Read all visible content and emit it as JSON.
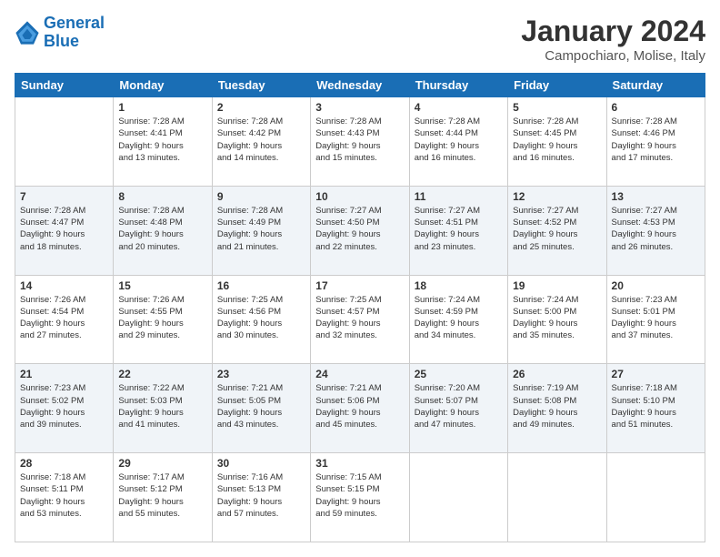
{
  "logo": {
    "line1": "General",
    "line2": "Blue"
  },
  "title": "January 2024",
  "location": "Campochiaro, Molise, Italy",
  "weekdays": [
    "Sunday",
    "Monday",
    "Tuesday",
    "Wednesday",
    "Thursday",
    "Friday",
    "Saturday"
  ],
  "weeks": [
    [
      {
        "day": "",
        "info": ""
      },
      {
        "day": "1",
        "info": "Sunrise: 7:28 AM\nSunset: 4:41 PM\nDaylight: 9 hours\nand 13 minutes."
      },
      {
        "day": "2",
        "info": "Sunrise: 7:28 AM\nSunset: 4:42 PM\nDaylight: 9 hours\nand 14 minutes."
      },
      {
        "day": "3",
        "info": "Sunrise: 7:28 AM\nSunset: 4:43 PM\nDaylight: 9 hours\nand 15 minutes."
      },
      {
        "day": "4",
        "info": "Sunrise: 7:28 AM\nSunset: 4:44 PM\nDaylight: 9 hours\nand 16 minutes."
      },
      {
        "day": "5",
        "info": "Sunrise: 7:28 AM\nSunset: 4:45 PM\nDaylight: 9 hours\nand 16 minutes."
      },
      {
        "day": "6",
        "info": "Sunrise: 7:28 AM\nSunset: 4:46 PM\nDaylight: 9 hours\nand 17 minutes."
      }
    ],
    [
      {
        "day": "7",
        "info": "Sunrise: 7:28 AM\nSunset: 4:47 PM\nDaylight: 9 hours\nand 18 minutes."
      },
      {
        "day": "8",
        "info": "Sunrise: 7:28 AM\nSunset: 4:48 PM\nDaylight: 9 hours\nand 20 minutes."
      },
      {
        "day": "9",
        "info": "Sunrise: 7:28 AM\nSunset: 4:49 PM\nDaylight: 9 hours\nand 21 minutes."
      },
      {
        "day": "10",
        "info": "Sunrise: 7:27 AM\nSunset: 4:50 PM\nDaylight: 9 hours\nand 22 minutes."
      },
      {
        "day": "11",
        "info": "Sunrise: 7:27 AM\nSunset: 4:51 PM\nDaylight: 9 hours\nand 23 minutes."
      },
      {
        "day": "12",
        "info": "Sunrise: 7:27 AM\nSunset: 4:52 PM\nDaylight: 9 hours\nand 25 minutes."
      },
      {
        "day": "13",
        "info": "Sunrise: 7:27 AM\nSunset: 4:53 PM\nDaylight: 9 hours\nand 26 minutes."
      }
    ],
    [
      {
        "day": "14",
        "info": "Sunrise: 7:26 AM\nSunset: 4:54 PM\nDaylight: 9 hours\nand 27 minutes."
      },
      {
        "day": "15",
        "info": "Sunrise: 7:26 AM\nSunset: 4:55 PM\nDaylight: 9 hours\nand 29 minutes."
      },
      {
        "day": "16",
        "info": "Sunrise: 7:25 AM\nSunset: 4:56 PM\nDaylight: 9 hours\nand 30 minutes."
      },
      {
        "day": "17",
        "info": "Sunrise: 7:25 AM\nSunset: 4:57 PM\nDaylight: 9 hours\nand 32 minutes."
      },
      {
        "day": "18",
        "info": "Sunrise: 7:24 AM\nSunset: 4:59 PM\nDaylight: 9 hours\nand 34 minutes."
      },
      {
        "day": "19",
        "info": "Sunrise: 7:24 AM\nSunset: 5:00 PM\nDaylight: 9 hours\nand 35 minutes."
      },
      {
        "day": "20",
        "info": "Sunrise: 7:23 AM\nSunset: 5:01 PM\nDaylight: 9 hours\nand 37 minutes."
      }
    ],
    [
      {
        "day": "21",
        "info": "Sunrise: 7:23 AM\nSunset: 5:02 PM\nDaylight: 9 hours\nand 39 minutes."
      },
      {
        "day": "22",
        "info": "Sunrise: 7:22 AM\nSunset: 5:03 PM\nDaylight: 9 hours\nand 41 minutes."
      },
      {
        "day": "23",
        "info": "Sunrise: 7:21 AM\nSunset: 5:05 PM\nDaylight: 9 hours\nand 43 minutes."
      },
      {
        "day": "24",
        "info": "Sunrise: 7:21 AM\nSunset: 5:06 PM\nDaylight: 9 hours\nand 45 minutes."
      },
      {
        "day": "25",
        "info": "Sunrise: 7:20 AM\nSunset: 5:07 PM\nDaylight: 9 hours\nand 47 minutes."
      },
      {
        "day": "26",
        "info": "Sunrise: 7:19 AM\nSunset: 5:08 PM\nDaylight: 9 hours\nand 49 minutes."
      },
      {
        "day": "27",
        "info": "Sunrise: 7:18 AM\nSunset: 5:10 PM\nDaylight: 9 hours\nand 51 minutes."
      }
    ],
    [
      {
        "day": "28",
        "info": "Sunrise: 7:18 AM\nSunset: 5:11 PM\nDaylight: 9 hours\nand 53 minutes."
      },
      {
        "day": "29",
        "info": "Sunrise: 7:17 AM\nSunset: 5:12 PM\nDaylight: 9 hours\nand 55 minutes."
      },
      {
        "day": "30",
        "info": "Sunrise: 7:16 AM\nSunset: 5:13 PM\nDaylight: 9 hours\nand 57 minutes."
      },
      {
        "day": "31",
        "info": "Sunrise: 7:15 AM\nSunset: 5:15 PM\nDaylight: 9 hours\nand 59 minutes."
      },
      {
        "day": "",
        "info": ""
      },
      {
        "day": "",
        "info": ""
      },
      {
        "day": "",
        "info": ""
      }
    ]
  ]
}
